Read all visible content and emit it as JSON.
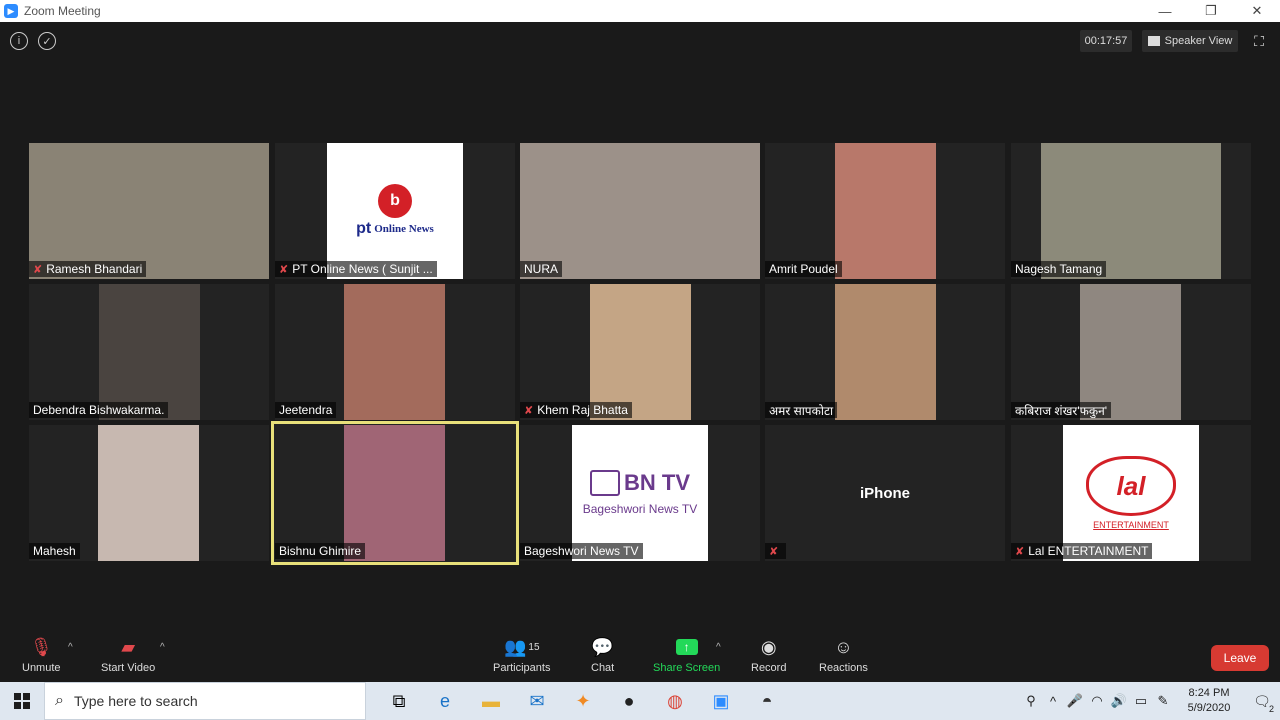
{
  "window": {
    "title": "Zoom Meeting",
    "minimize": "—",
    "restore": "❐",
    "close": "✕"
  },
  "header": {
    "timer": "00:17:57",
    "view_label": "Speaker View"
  },
  "participants": [
    {
      "name": "Ramesh Bhandari",
      "muted": true,
      "video_color": "#8a8375"
    },
    {
      "name": "PT Online News ( Sunjit ...",
      "muted": true,
      "video_color": "#ffffff",
      "logo_text": "Online News",
      "logo_mark": "pt"
    },
    {
      "name": "NURA",
      "muted": false,
      "video_color": "#9c9189"
    },
    {
      "name": "Amrit Poudel",
      "muted": false,
      "video_color": "#b8786a"
    },
    {
      "name": "Nagesh Tamang",
      "muted": false,
      "video_color": "#8c8a7a"
    },
    {
      "name": "Debendra Bishwakarma.",
      "muted": false,
      "video_color": "#4a4440"
    },
    {
      "name": "Jeetendra",
      "muted": false,
      "video_color": "#a36b5c"
    },
    {
      "name": "Khem Raj Bhatta",
      "muted": true,
      "video_color": "#c4a585"
    },
    {
      "name": "अमर सापकोटा",
      "muted": false,
      "video_color": "#b08a6c"
    },
    {
      "name": "कबिराज शंखर'फकुन'",
      "muted": false,
      "video_color": "#8f8780"
    },
    {
      "name": "Mahesh",
      "muted": false,
      "video_color": "#c7b8b0"
    },
    {
      "name": "Bishnu Ghimire",
      "muted": false,
      "video_color": "#a06575",
      "active": true
    },
    {
      "name": "Bageshwori News TV",
      "muted": false,
      "video_color": "#ffffff",
      "logo_text": "BN TV",
      "logo_sub": "Bageshwori News TV"
    },
    {
      "name": "",
      "muted": true,
      "video_color": "#232323",
      "center_text": "iPhone"
    },
    {
      "name": "Lal ENTERTAINMENT",
      "muted": true,
      "video_color": "#ffffff",
      "logo_text": "lal",
      "logo_sub": "ENTERTAINMENT"
    }
  ],
  "toolbar": {
    "unmute": "Unmute",
    "start_video": "Start Video",
    "participants": "Participants",
    "participants_count": "15",
    "chat": "Chat",
    "share_screen": "Share Screen",
    "record": "Record",
    "reactions": "Reactions",
    "leave": "Leave"
  },
  "taskbar": {
    "search_placeholder": "Type here to search",
    "time": "8:24 PM",
    "date": "5/9/2020",
    "notifications": "2"
  },
  "colors": {
    "share_green": "#23d959",
    "leave_red": "#d73a32",
    "active_border": "#e8e07a"
  }
}
